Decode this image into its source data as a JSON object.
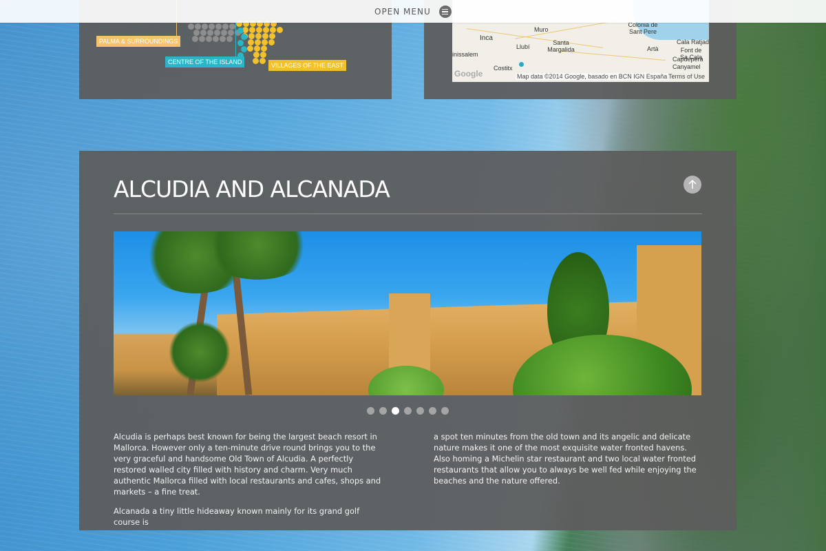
{
  "header": {
    "menu_label": "OPEN MENU"
  },
  "region_map": {
    "tags": {
      "palma": "PALMA & SURROUNDINGS",
      "centre": "CENTRE OF THE ISLAND",
      "east": "VILLAGES OF THE EAST"
    },
    "colors": {
      "palma": "#f6c26b",
      "centre": "#27b7c9",
      "east": "#f3c12b",
      "grey_hex": "#8e8e8e"
    }
  },
  "google_map": {
    "places": [
      "Inca",
      "Muro",
      "Colonia de Sant Pere",
      "Cala Ratjada",
      "Santa Margalida",
      "Artà",
      "Font de Sa Cala",
      "Llubí",
      "inissalem",
      "Capdepera",
      "Canyamel",
      "Costitx"
    ],
    "credit": "Map data ©2014 Google, basado en BCN IGN España",
    "terms": "Terms of Use",
    "logo_text": "Google"
  },
  "section": {
    "title": "ALCUDIA AND ALCANADA",
    "slider": {
      "total": 7,
      "active_index": 2
    },
    "column_left": [
      "Alcudia is perhaps best known for being the largest beach resort in Mallorca. However only a ten-minute drive round brings you to the very graceful and handsome Old Town of Alcudia. A perfectly restored walled city filled with history and charm. Very much authentic Mallorca filled with local restaurants and cafes, shops and markets – a fine treat.",
      "Alcanada a tiny little hideaway known mainly for its grand golf course is"
    ],
    "column_right": [
      "a spot ten minutes from the old town and its angelic and delicate nature makes it one of the most exquisite water fronted havens. Also homing a Michelin star restaurant and two local water fronted restaurants that allow you to always be well fed while enjoying the beaches and the nature offered."
    ]
  }
}
